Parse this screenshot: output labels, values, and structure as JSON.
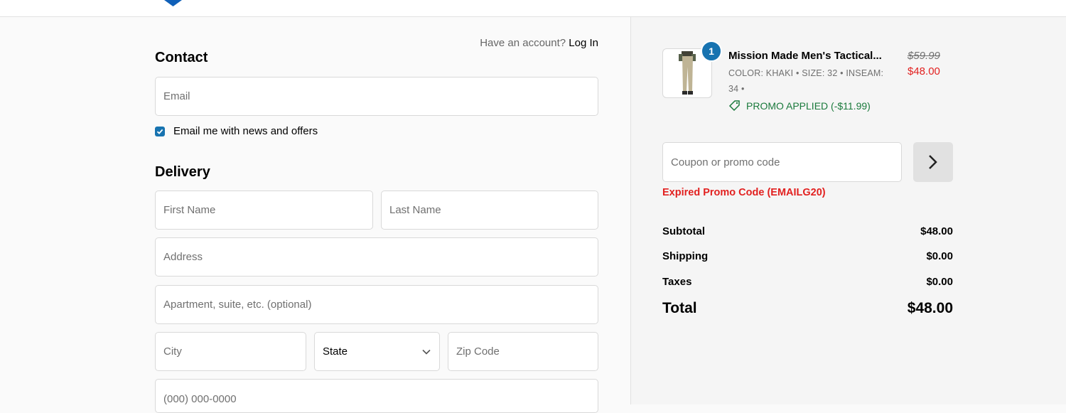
{
  "contact": {
    "heading": "Contact",
    "account_prompt": "Have an account?",
    "login_label": "Log In",
    "email_placeholder": "Email",
    "newsletter_label": "Email me with news and offers",
    "newsletter_checked": true
  },
  "delivery": {
    "heading": "Delivery",
    "first_name_placeholder": "First Name",
    "last_name_placeholder": "Last Name",
    "address_placeholder": "Address",
    "apartment_placeholder": "Apartment, suite, etc. (optional)",
    "city_placeholder": "City",
    "state_value": "State",
    "zip_placeholder": "Zip Code",
    "phone_placeholder": "(000) 000-0000"
  },
  "summary": {
    "item": {
      "quantity": "1",
      "title": "Mission Made Men's Tactical...",
      "variant_line1": "COLOR: KHAKI • SIZE: 32 • INSEAM:",
      "variant_line2": "34 •",
      "promo": "PROMO APPLIED (-$11.99)",
      "original_price": "$59.99",
      "sale_price": "$48.00"
    },
    "coupon_placeholder": "Coupon or promo code",
    "coupon_error": "Expired Promo Code (EMAILG20)",
    "subtotal_label": "Subtotal",
    "subtotal_value": "$48.00",
    "shipping_label": "Shipping",
    "shipping_value": "$0.00",
    "taxes_label": "Taxes",
    "taxes_value": "$0.00",
    "total_label": "Total",
    "total_value": "$48.00"
  },
  "colors": {
    "accent": "#1773b0",
    "error": "#e22120",
    "promo": "#1a7a3c"
  }
}
